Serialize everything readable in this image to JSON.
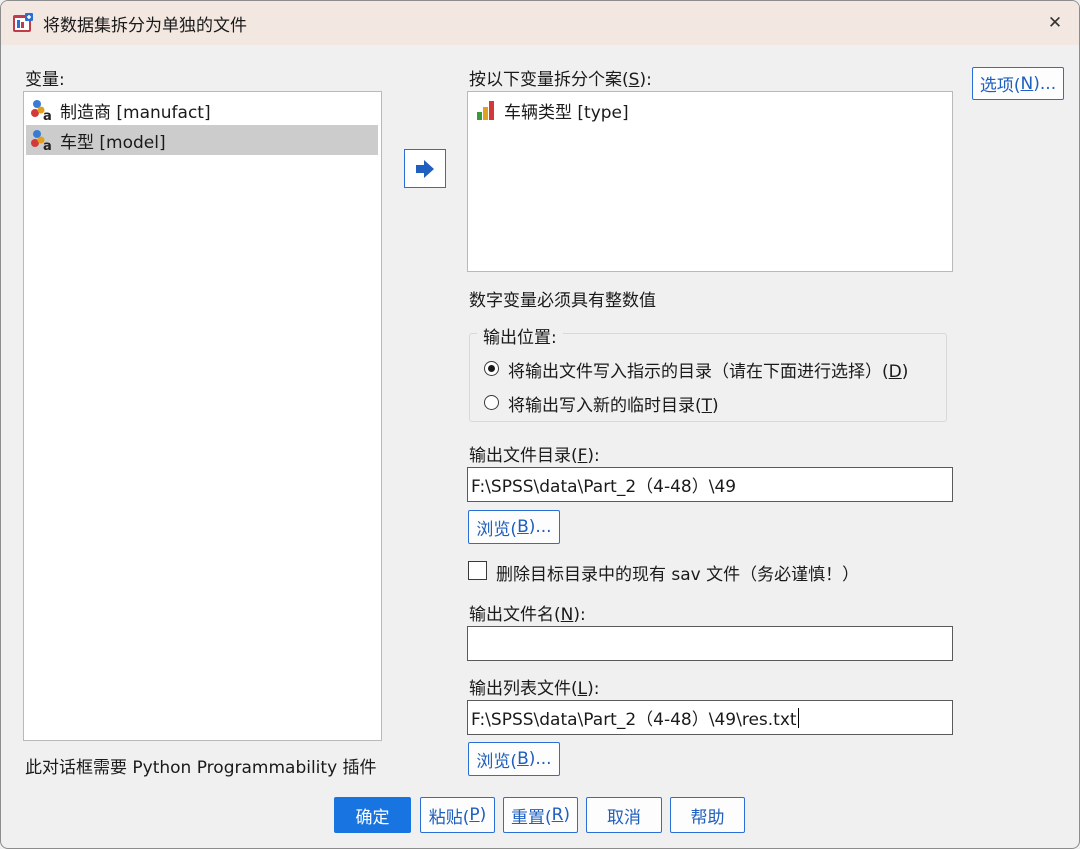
{
  "window": {
    "title": "将数据集拆分为单独的文件",
    "close_glyph": "✕"
  },
  "variables": {
    "label": "变量:",
    "items": [
      {
        "label": "制造商 [manufact]",
        "icon": "nominal-string-variable-icon",
        "selected": false
      },
      {
        "label": "车型 [model]",
        "icon": "nominal-string-variable-icon",
        "selected": true
      }
    ]
  },
  "split_by": {
    "label_pre": "按以下变量拆分个案(",
    "label_key": "S",
    "label_post": "):",
    "items": [
      {
        "label": "车辆类型 [type]",
        "icon": "ordinal-variable-icon"
      }
    ],
    "note": "数字变量必须具有整数值"
  },
  "options_button": {
    "pre": "选项(",
    "key": "N",
    "post": ")..."
  },
  "output_location": {
    "title": "输出位置:",
    "option1": {
      "pre": "将输出文件写入指示的目录（请在下面进行选择）(",
      "key": "D",
      "post": ")",
      "checked": true
    },
    "option2": {
      "pre": "将输出写入新的临时目录(",
      "key": "T",
      "post": ")",
      "checked": false
    }
  },
  "output_dir": {
    "label_pre": "输出文件目录(",
    "label_key": "F",
    "label_post": "):",
    "value": "F:\\SPSS\\data\\Part_2（4-48）\\49"
  },
  "browse1": {
    "pre": "浏览(",
    "key": "B",
    "post": ")..."
  },
  "delete_existing": {
    "label": "删除目标目录中的现有 sav 文件（务必谨慎！）",
    "checked": false
  },
  "output_filename": {
    "label_pre": "输出文件名(",
    "label_key": "N",
    "label_post": "):",
    "value": ""
  },
  "output_listing": {
    "label_pre": "输出列表文件(",
    "label_key": "L",
    "label_post": "):",
    "value": "F:\\SPSS\\data\\Part_2（4-48）\\49\\res.txt"
  },
  "browse2": {
    "pre": "浏览(",
    "key": "B",
    "post": ")..."
  },
  "plugin_note": "此对话框需要 Python Programmability 插件",
  "footer": {
    "ok": "确定",
    "paste": {
      "pre": "粘贴(",
      "key": "P",
      "post": ")"
    },
    "reset": {
      "pre": "重置(",
      "key": "R",
      "post": ")"
    },
    "cancel": "取消",
    "help": "帮助"
  },
  "colors": {
    "accent": "#1874e0",
    "titlebar": "#f3e8e1",
    "selection": "#cccccc"
  }
}
